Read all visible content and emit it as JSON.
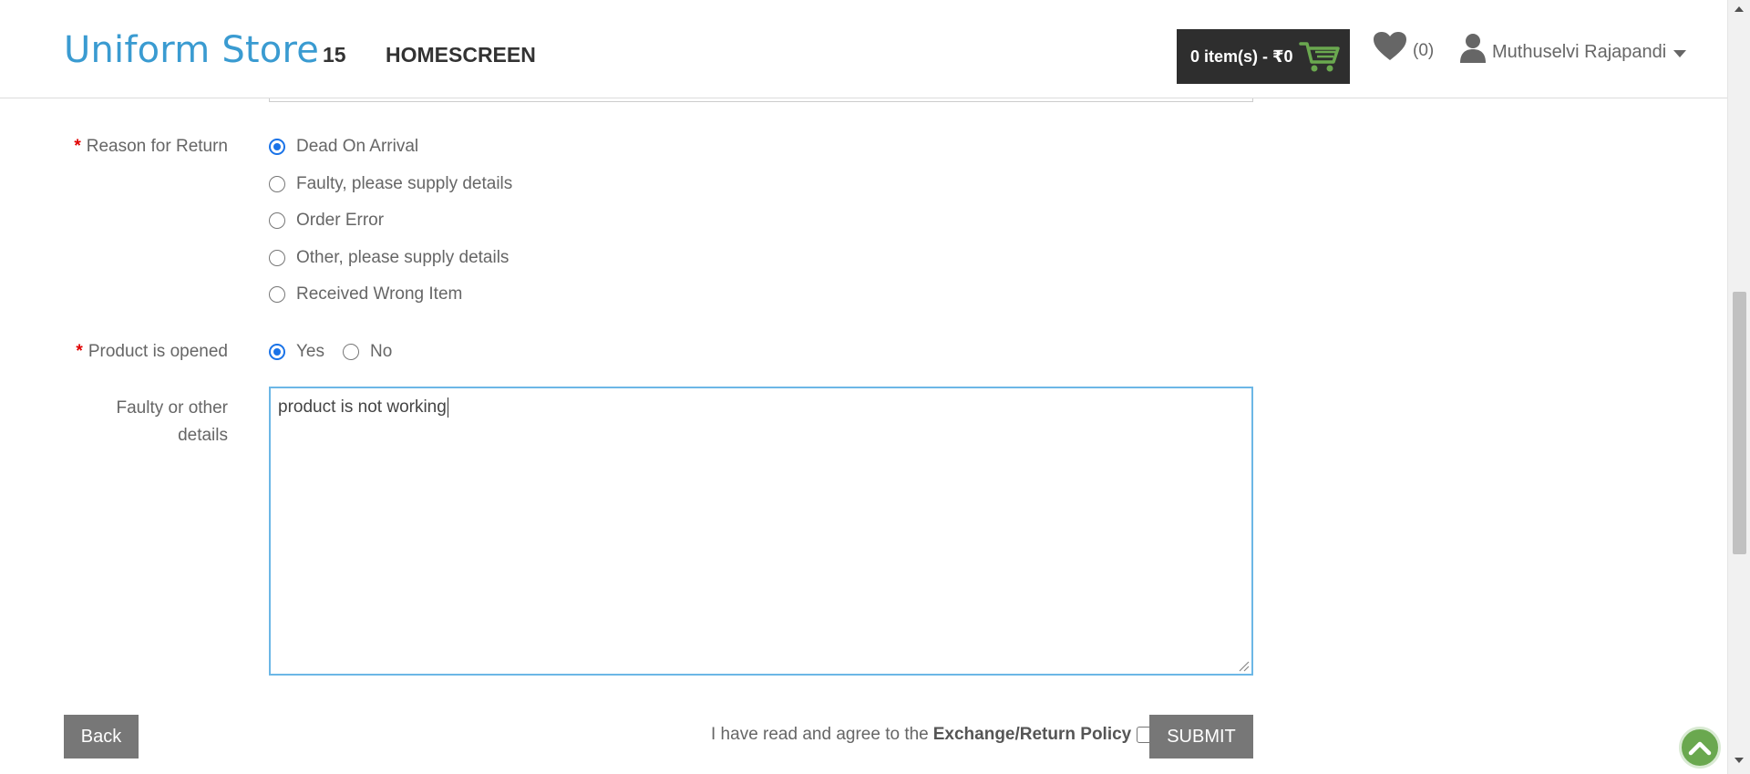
{
  "header": {
    "brand": "Uniform Store",
    "nav_number": "15",
    "nav_home": "HOMESCREEN",
    "cart_label": "0 item(s) - ₹0",
    "wishlist_count": "(0)",
    "user_name": "Muthuselvi Rajapandi"
  },
  "form": {
    "reason_label": "Reason for Return",
    "reasons": [
      {
        "label": "Dead On Arrival",
        "checked": true
      },
      {
        "label": "Faulty, please supply details",
        "checked": false
      },
      {
        "label": "Order Error",
        "checked": false
      },
      {
        "label": "Other, please supply details",
        "checked": false
      },
      {
        "label": "Received Wrong Item",
        "checked": false
      }
    ],
    "opened_label": "Product is opened",
    "opened_yes": "Yes",
    "opened_no": "No",
    "opened_value": "Yes",
    "details_label_line1": "Faulty or other",
    "details_label_line2": "details",
    "details_value": "product is not working"
  },
  "footer": {
    "back_label": "Back",
    "agree_text": "I have read and agree to the",
    "policy_link": "Exchange/Return Policy",
    "submit_label": "SUBMIT"
  },
  "colors": {
    "brand": "#3a9bd1",
    "cart_bg": "#2e2e2e",
    "cart_icon": "#6aa84f",
    "button_bg": "#777777",
    "radio_checked": "#1a73e8",
    "required": "#e00000",
    "focus_border": "#6cb7e6"
  }
}
